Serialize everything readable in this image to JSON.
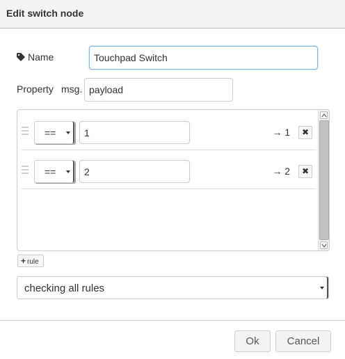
{
  "dialog": {
    "title": "Edit switch node"
  },
  "name_field": {
    "label": "Name",
    "icon": "tag-icon",
    "value": "Touchpad Switch"
  },
  "property_field": {
    "label": "Property",
    "prefix": "msg.",
    "value": "payload"
  },
  "rules": [
    {
      "operator": "==",
      "value": "1",
      "output": "→ 1",
      "remove": "✖"
    },
    {
      "operator": "==",
      "value": "2",
      "output": "→ 2",
      "remove": "✖"
    }
  ],
  "add_rule": {
    "icon": "+",
    "label": "rule"
  },
  "checking_mode": {
    "selected": "checking all rules"
  },
  "footer": {
    "ok_label": "Ok",
    "cancel_label": "Cancel"
  }
}
